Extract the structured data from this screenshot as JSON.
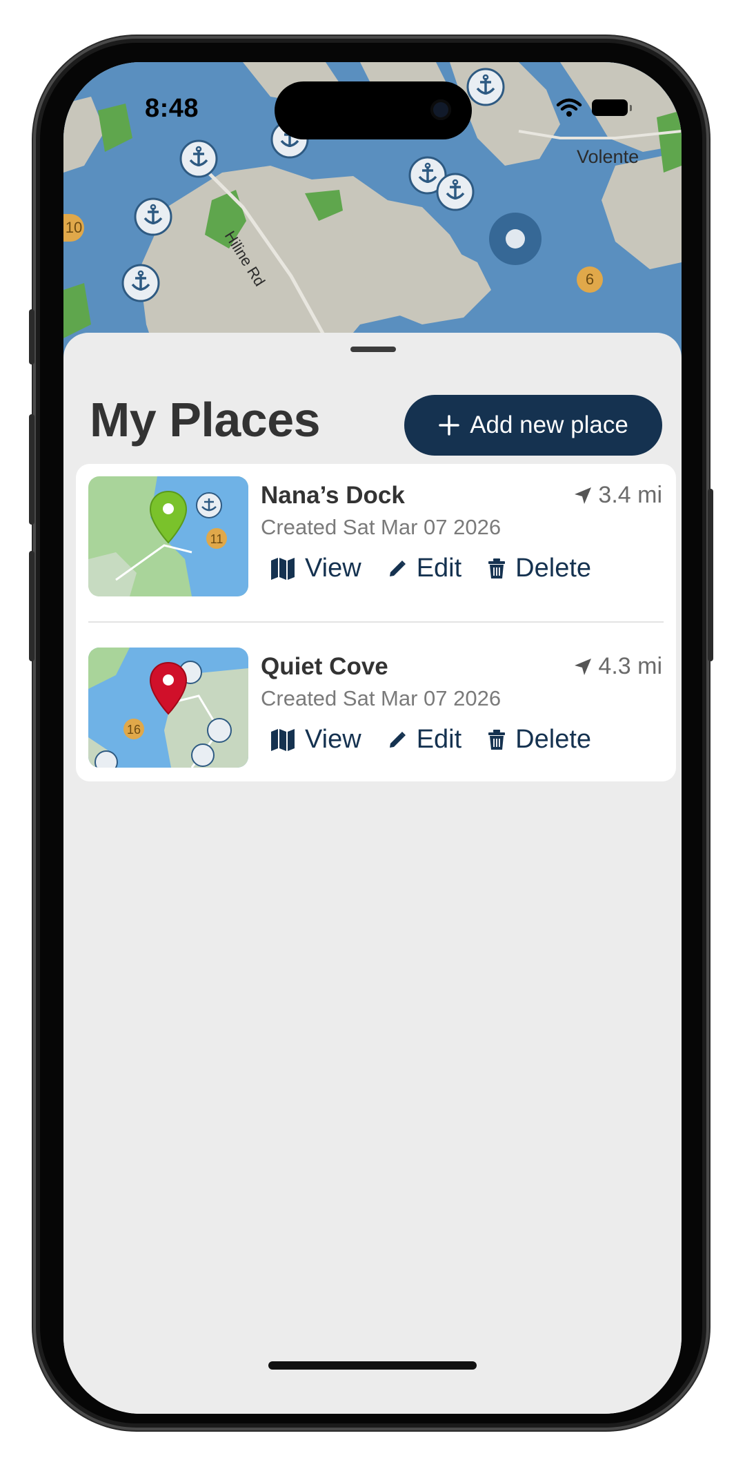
{
  "status_bar": {
    "time": "8:48"
  },
  "map": {
    "place_label": "Volente",
    "road_label": "Hiline Rd",
    "cluster_counts": [
      "10",
      "6"
    ]
  },
  "sheet": {
    "title": "My Places",
    "add_button_label": "Add new place",
    "places": [
      {
        "name": "Nana’s Dock",
        "distance": "3.4 mi",
        "created": "Created Sat Mar 07 2026",
        "marker_color": "#7ac22b",
        "thumb_badges": [
          "11"
        ],
        "actions": {
          "view": "View",
          "edit": "Edit",
          "delete": "Delete"
        }
      },
      {
        "name": "Quiet Cove",
        "distance": "4.3 mi",
        "created": "Created Sat Mar 07 2026",
        "marker_color": "#d0102a",
        "thumb_badges": [
          "16"
        ],
        "actions": {
          "view": "View",
          "edit": "Edit",
          "delete": "Delete"
        }
      }
    ]
  },
  "colors": {
    "accent": "#153250",
    "sheet_bg": "#ececec",
    "water": "#5a8fbf",
    "land": "#c8c6bb",
    "park": "#5fa64d"
  },
  "icons": [
    "anchor-icon",
    "wifi-icon",
    "battery-icon",
    "location-arrow-icon",
    "map-icon",
    "pencil-icon",
    "trash-icon",
    "plus-icon",
    "map-pin-icon"
  ]
}
